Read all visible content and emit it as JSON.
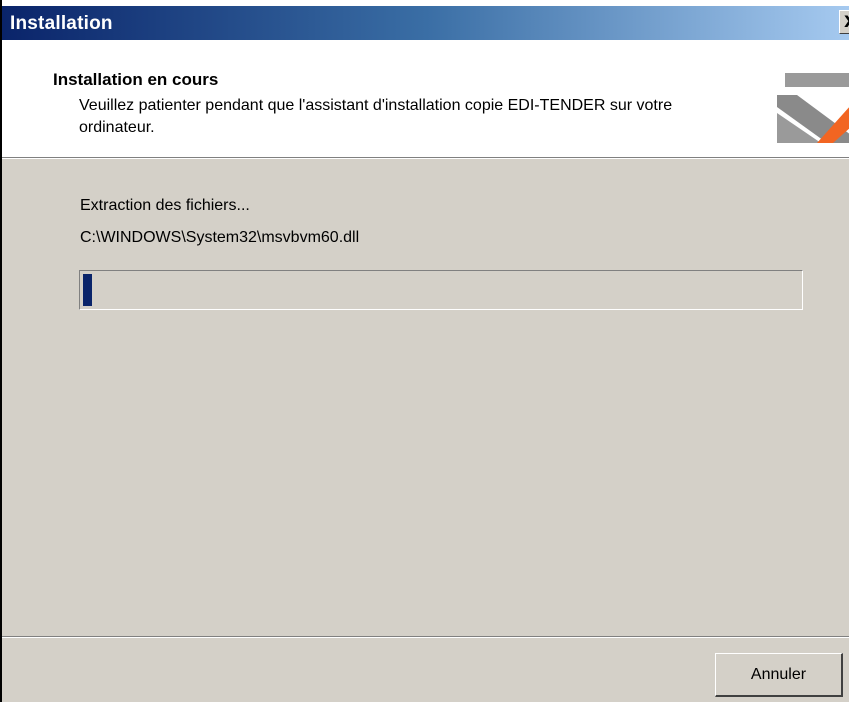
{
  "window": {
    "title": "Installation",
    "close_glyph": "X"
  },
  "header": {
    "title": "Installation en cours",
    "description": "Veuillez patienter pendant que l'assistant d'installation copie EDI-TENDER sur votre ordinateur.",
    "logo_icon": "edi-tender-logo-icon"
  },
  "main": {
    "status_label": "Extraction des fichiers...",
    "current_file": "C:\\WINDOWS\\System32\\msvbvm60.dll",
    "progress_fraction": 0.012
  },
  "footer": {
    "cancel_label": "Annuler"
  },
  "colors": {
    "titlebar_start": "#0a246a",
    "titlebar_end": "#a6caf0",
    "progress_fill": "#0a246a",
    "dialog_bg": "#d4d0c8",
    "logo_gray": "#8a8a8a",
    "logo_orange": "#f26522"
  }
}
